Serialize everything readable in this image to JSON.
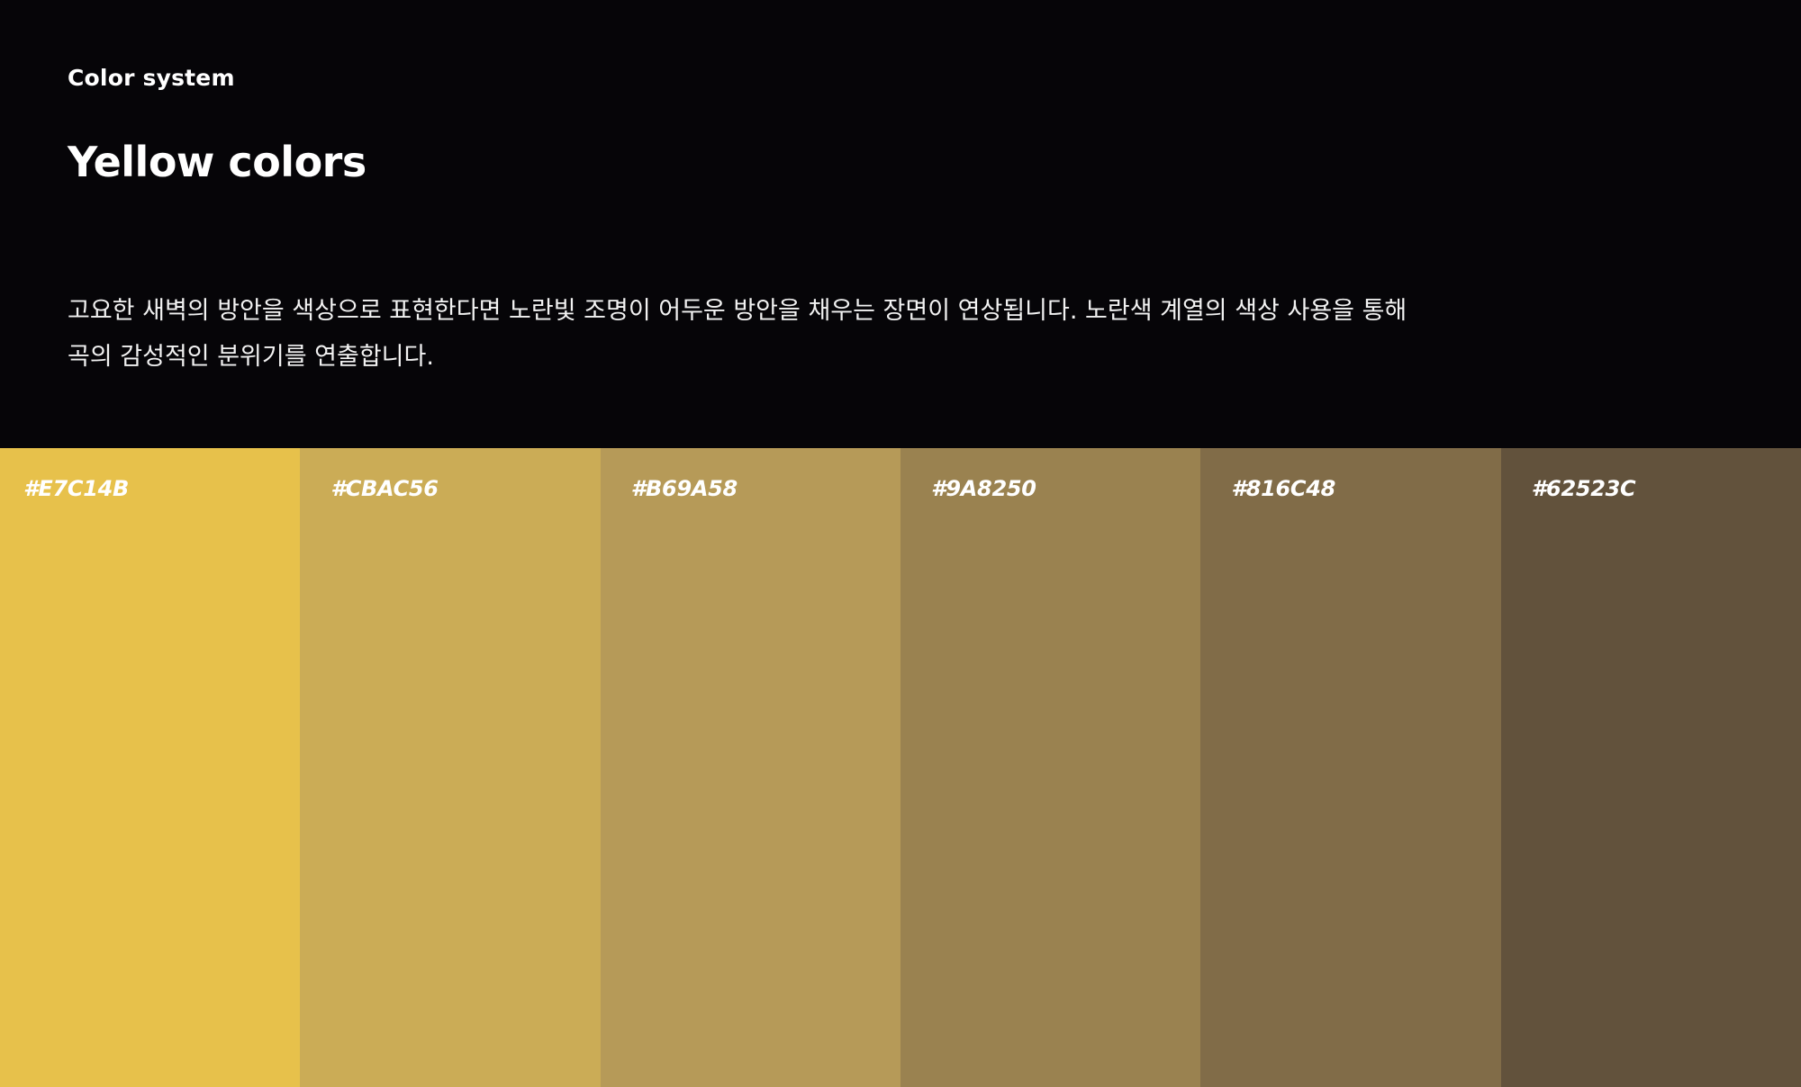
{
  "header": {
    "eyebrow": "Color system",
    "title": "Yellow colors",
    "description": "고요한 새벽의 방안을 색상으로 표현한다면 노란빛 조명이 어두운 방안을 채우는 장면이 연상됩니다. 노란색 계열의 색상 사용을 통해 곡의 감성적인 분위기를 연출합니다."
  },
  "colors": {
    "background": "#060508",
    "text": "#FFFFFF"
  },
  "swatches": [
    {
      "label": "#E7C14B",
      "color": "#E7C14B"
    },
    {
      "label": "#CBAC56",
      "color": "#CBAC56"
    },
    {
      "label": "#B69A58",
      "color": "#B69A58"
    },
    {
      "label": "#9A8250",
      "color": "#9A8250"
    },
    {
      "label": "#816C48",
      "color": "#816C48"
    },
    {
      "label": "#62523C",
      "color": "#62523C"
    }
  ]
}
